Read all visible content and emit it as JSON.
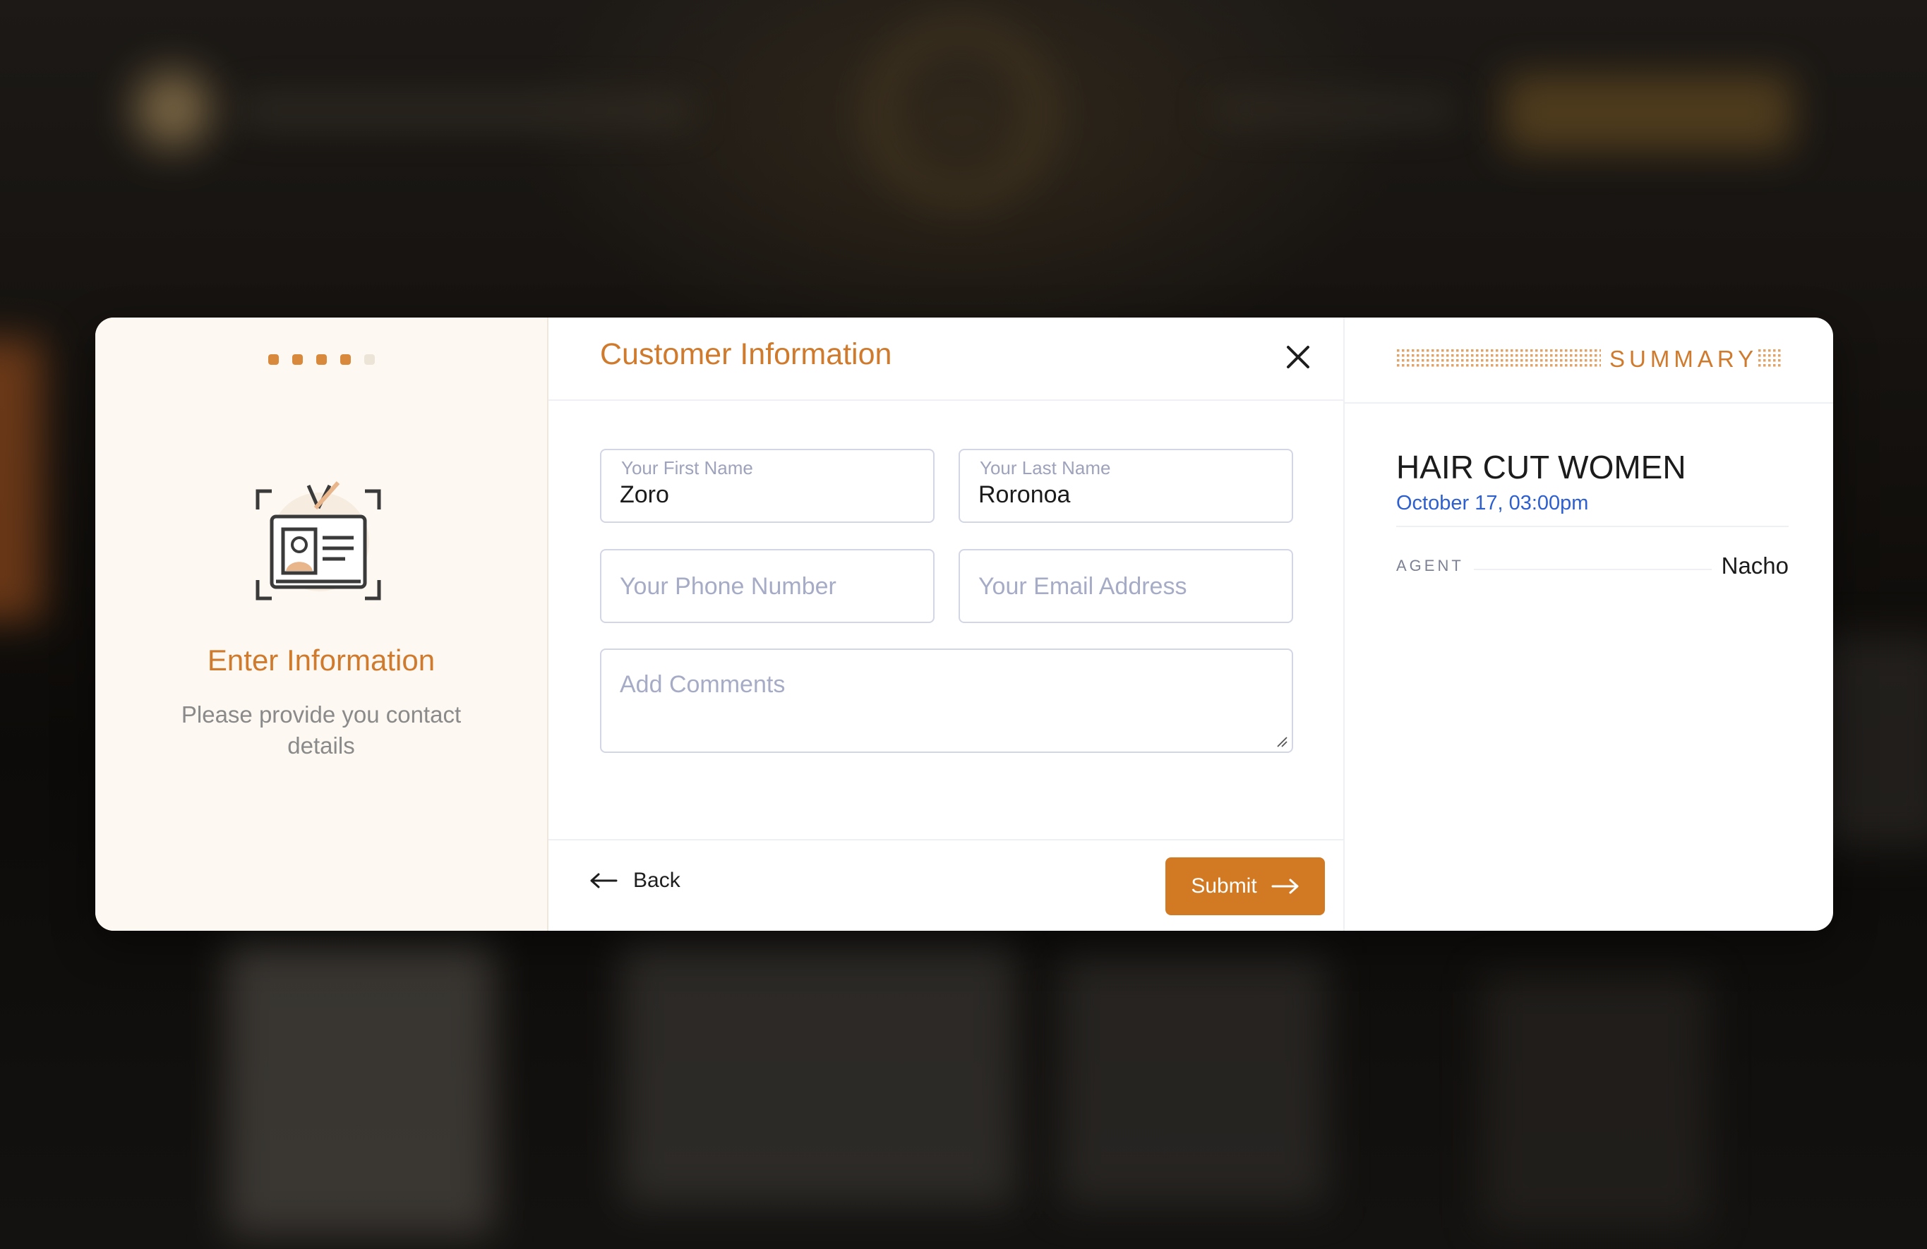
{
  "steps": {
    "total": 5,
    "current": 4
  },
  "left_panel": {
    "title": "Enter Information",
    "description": "Please provide you contact details",
    "icon": "id-badge-icon"
  },
  "form": {
    "title": "Customer Information",
    "first_name": {
      "label": "Your First Name",
      "value": "Zoro"
    },
    "last_name": {
      "label": "Your Last Name",
      "value": "Roronoa"
    },
    "phone": {
      "placeholder": "Your Phone Number",
      "value": ""
    },
    "email": {
      "placeholder": "Your Email Address",
      "value": ""
    },
    "comments": {
      "placeholder": "Add Comments",
      "value": ""
    },
    "back_label": "Back",
    "submit_label": "Submit"
  },
  "summary": {
    "heading": "SUMMARY",
    "service": "HAIR CUT WOMEN",
    "datetime": "October 17, 03:00pm",
    "agent_label": "AGENT",
    "agent_value": "Nacho"
  },
  "colors": {
    "accent": "#d27a23",
    "accent_text": "#cf7a2c",
    "link_blue": "#2d5fce",
    "left_panel_bg": "#fdf8f1"
  }
}
